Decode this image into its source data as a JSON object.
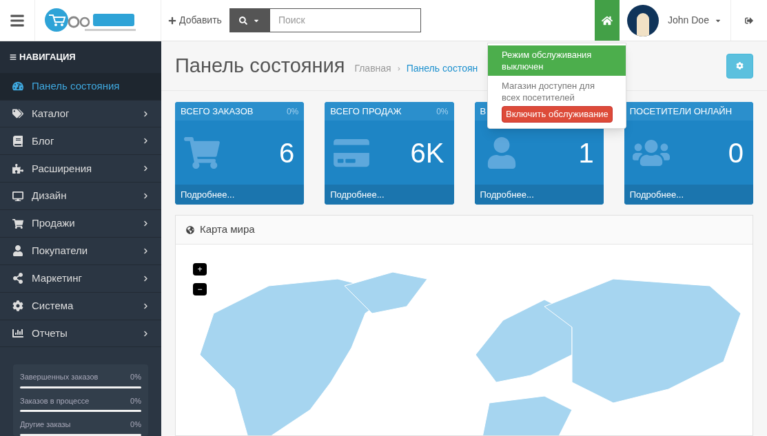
{
  "header": {
    "add_button": "Добавить",
    "search": {
      "placeholder": "Поиск"
    },
    "user": {
      "name": "John Doe"
    }
  },
  "maintenance_menu": {
    "status": "Режим обслуживания выключен",
    "description": "Магазин доступен для всех посетителей",
    "button": "Включить обслуживание"
  },
  "sidebar": {
    "title": "НАВИГАЦИЯ",
    "items": [
      {
        "label": "Панель состояния",
        "selected": true,
        "has_submenu": false
      },
      {
        "label": "Каталог",
        "selected": false,
        "has_submenu": true
      },
      {
        "label": "Блог",
        "selected": false,
        "has_submenu": true
      },
      {
        "label": "Расширения",
        "selected": false,
        "has_submenu": true
      },
      {
        "label": "Дизайн",
        "selected": false,
        "has_submenu": true
      },
      {
        "label": "Продажи",
        "selected": false,
        "has_submenu": true
      },
      {
        "label": "Покупатели",
        "selected": false,
        "has_submenu": true
      },
      {
        "label": "Маркетинг",
        "selected": false,
        "has_submenu": true
      },
      {
        "label": "Система",
        "selected": false,
        "has_submenu": true
      },
      {
        "label": "Отчеты",
        "selected": false,
        "has_submenu": true
      }
    ],
    "stats": [
      {
        "label": "Завершенных заказов",
        "value": "0%"
      },
      {
        "label": "Заказов в процессе",
        "value": "0%"
      },
      {
        "label": "Другие заказы",
        "value": "0%"
      }
    ]
  },
  "page": {
    "title": "Панель состояния",
    "breadcrumb": [
      "Главная",
      "Панель состоян"
    ]
  },
  "tiles": [
    {
      "title": "ВСЕГО ЗАКАЗОВ",
      "percent": "0%",
      "value": "6",
      "link": "Подробнее..."
    },
    {
      "title": "ВСЕГО ПРОДАЖ",
      "percent": "0%",
      "value": "6K",
      "link": "Подробнее..."
    },
    {
      "title": "В",
      "value": "1",
      "link": "Подробнее..."
    },
    {
      "title": "ПОСЕТИТЕЛИ ОНЛАЙН",
      "value": "0",
      "link": "Подробнее..."
    }
  ],
  "map_panel": {
    "title": "Карта мира",
    "zoom_in": "+",
    "zoom_out": "−"
  }
}
